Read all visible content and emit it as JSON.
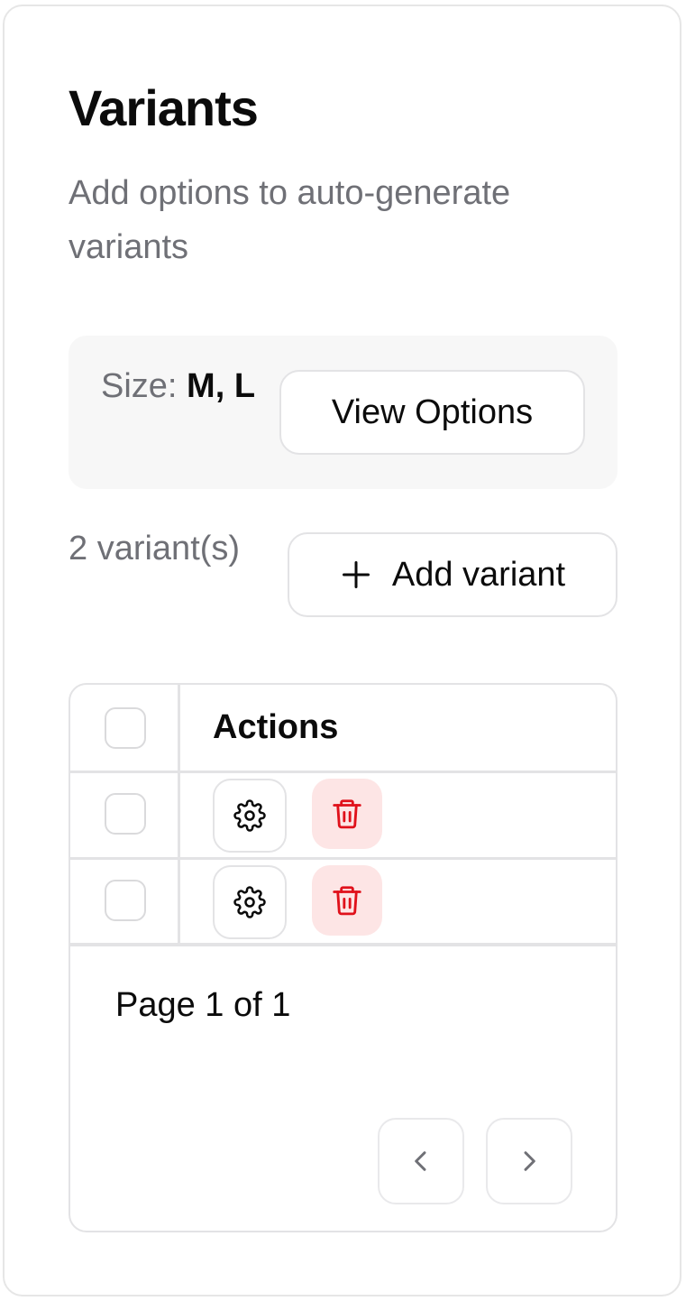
{
  "header": {
    "title": "Variants",
    "subtitle": "Add options to auto-generate variants"
  },
  "options": {
    "label": "Size:",
    "values": "M, L",
    "view_button": "View Options"
  },
  "variants": {
    "count_text": "2 variant(s)",
    "add_button": "Add variant"
  },
  "table": {
    "columns": [
      "Actions"
    ],
    "rows": [
      {
        "selected": false
      },
      {
        "selected": false
      }
    ]
  },
  "pagination": {
    "text": "Page 1 of 1"
  },
  "colors": {
    "danger": "#e0111b",
    "danger_bg": "#fde5e5",
    "muted_text": "#6f7076",
    "border": "#e3e3e5"
  },
  "icons": {
    "settings": "gear-icon",
    "delete": "trash-icon",
    "add": "plus-icon",
    "prev": "chevron-left-icon",
    "next": "chevron-right-icon"
  }
}
